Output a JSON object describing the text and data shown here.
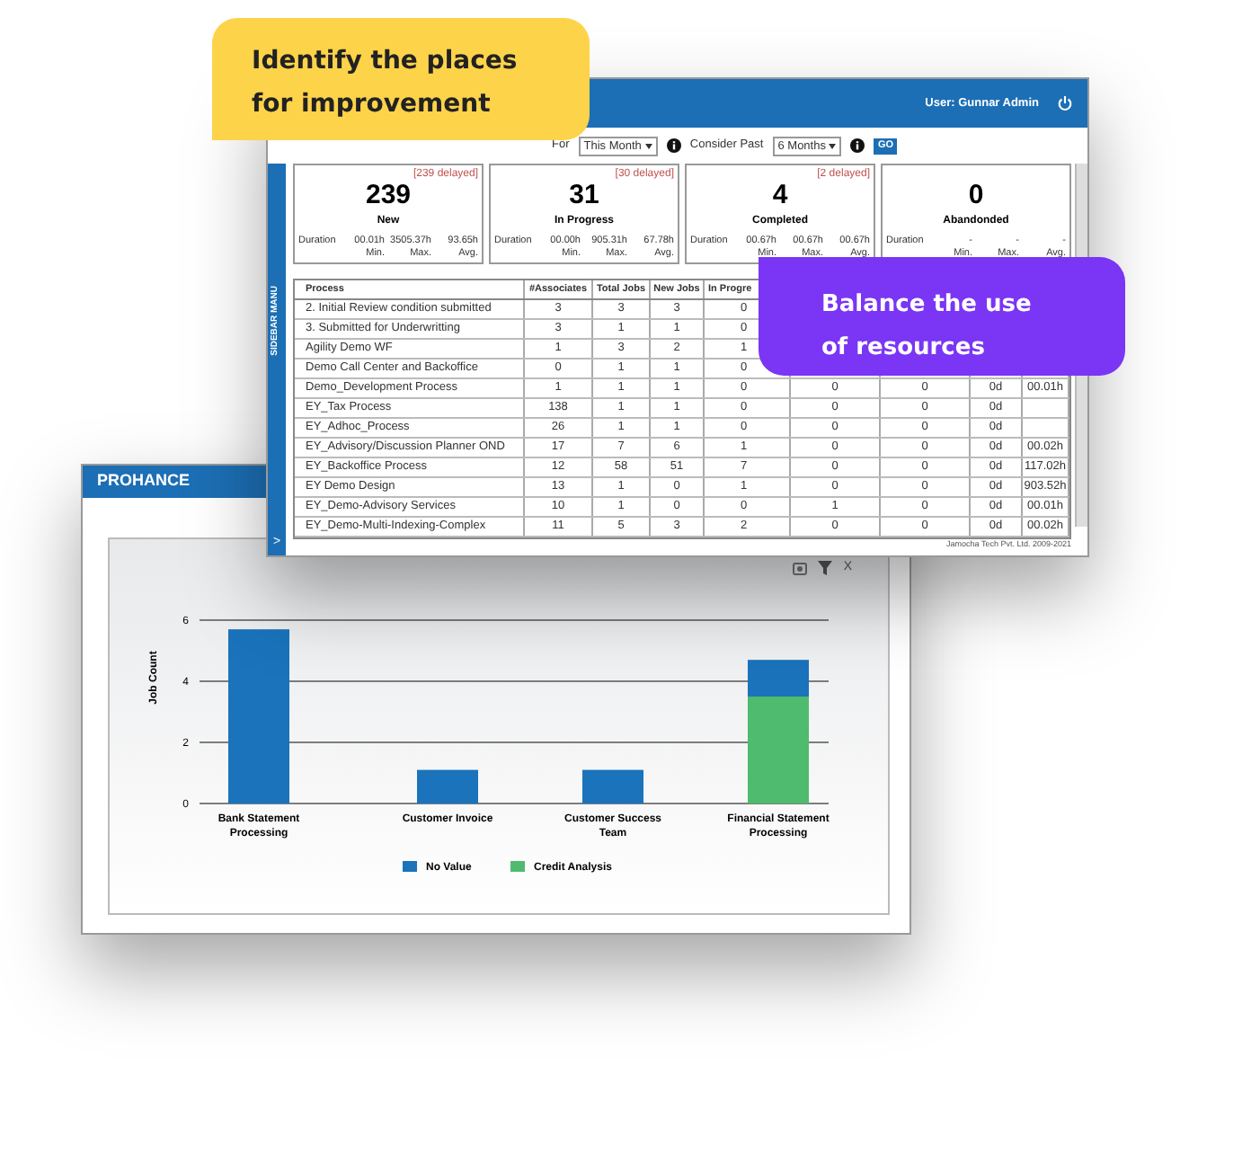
{
  "callouts": [
    {
      "kind": "note",
      "text": "Identify the places for improvement"
    },
    {
      "kind": "tip",
      "text": "Balance the use of resources"
    }
  ],
  "dashboard_window": {
    "user": "User: Gunnar Admin",
    "filters": {
      "report_for_label": "For",
      "period": "This Month",
      "consider_past_label": "Consider Past",
      "past_range": "6 Months",
      "go": "GO"
    },
    "sidebar_label": "SIDEBAR MANU",
    "sidebar_toggle": ">",
    "cards": [
      {
        "delayed": "[239 delayed]",
        "count": "239",
        "label": "New",
        "duration_label": "Duration",
        "min": "00.01h",
        "max": "3505.37h",
        "avg": "93.65h",
        "min_label": "Min.",
        "max_label": "Max.",
        "avg_label": "Avg."
      },
      {
        "delayed": "[30 delayed]",
        "count": "31",
        "label": "In Progress",
        "duration_label": "Duration",
        "min": "00.00h",
        "max": "905.31h",
        "avg": "67.78h",
        "min_label": "Min.",
        "max_label": "Max.",
        "avg_label": "Avg."
      },
      {
        "delayed": "[2 delayed]",
        "count": "4",
        "label": "Completed",
        "duration_label": "Duration",
        "min": "00.67h",
        "max": "00.67h",
        "avg": "00.67h",
        "min_label": "Min.",
        "max_label": "Max.",
        "avg_label": "Avg."
      },
      {
        "count": "0",
        "label": "Abandonded",
        "duration_label": "Duration",
        "min": "-",
        "max": "-",
        "avg": "-",
        "min_label": "Min.",
        "max_label": "Max.",
        "avg_label": "Avg."
      }
    ],
    "table": {
      "columns": [
        "Process",
        "#Associates",
        "Total Jobs",
        "New Jobs",
        "In Progre"
      ],
      "rows": [
        [
          "2. Initial Review condition submitted",
          "3",
          "3",
          "3",
          "0"
        ],
        [
          "3. Submitted for Underwritting",
          "3",
          "1",
          "1",
          "0"
        ],
        [
          "Agility Demo WF",
          "1",
          "3",
          "2",
          "1"
        ],
        [
          "Demo  Call Center and Backoffice",
          "0",
          "1",
          "1",
          "0"
        ],
        [
          "Demo_Development Process",
          "1",
          "1",
          "1",
          "0",
          "0",
          "0",
          "0d",
          "00.01h"
        ],
        [
          "EY_Tax Process",
          "138",
          "1",
          "1",
          "0",
          "0",
          "0",
          "0d",
          null
        ],
        [
          "EY_Adhoc_Process",
          "26",
          "1",
          "1",
          "0",
          "0",
          "0",
          "0d",
          null
        ],
        [
          "EY_Advisory/Discussion Planner OND",
          "17",
          "7",
          "6",
          "1",
          "0",
          "0",
          "0d",
          "00.02h"
        ],
        [
          "EY_Backoffice Process",
          "12",
          "58",
          "51",
          "7",
          "0",
          "0",
          "0d",
          "117.02h"
        ],
        [
          "EY  Demo  Design",
          "13",
          "1",
          "0",
          "1",
          "0",
          "0",
          "0d",
          "903.52h"
        ],
        [
          "EY_Demo-Advisory Services",
          "10",
          "1",
          "0",
          "0",
          "1",
          "0",
          "0d",
          "00.01h"
        ],
        [
          "EY_Demo-Multi-Indexing-Complex",
          "11",
          "5",
          "3",
          "2",
          "0",
          "0",
          "0d",
          "00.02h"
        ]
      ]
    },
    "footer": "Jamocha Tech Pvt. Ltd. 2009-2021"
  },
  "report_window": {
    "brand": "PROHANCE",
    "close": "X",
    "chart_data": {
      "type": "bar",
      "ylabel": "Job Count",
      "legend": "bottom",
      "stacked": true,
      "categories": [
        "Bank Statement Processing",
        "Customer Invoice",
        "Customer Success Team",
        "Financial Statement Processing"
      ],
      "yticks": [
        0,
        2,
        4,
        6
      ],
      "ylim": [
        0,
        6
      ],
      "series": [
        {
          "name": "No Value",
          "color": "#1a73bb",
          "values": [
            5.7,
            1.1,
            1.1,
            1.2
          ]
        },
        {
          "name": "Credit Analysis",
          "color": "#4fbb6e",
          "values": [
            null,
            null,
            null,
            3.5
          ]
        }
      ]
    }
  }
}
